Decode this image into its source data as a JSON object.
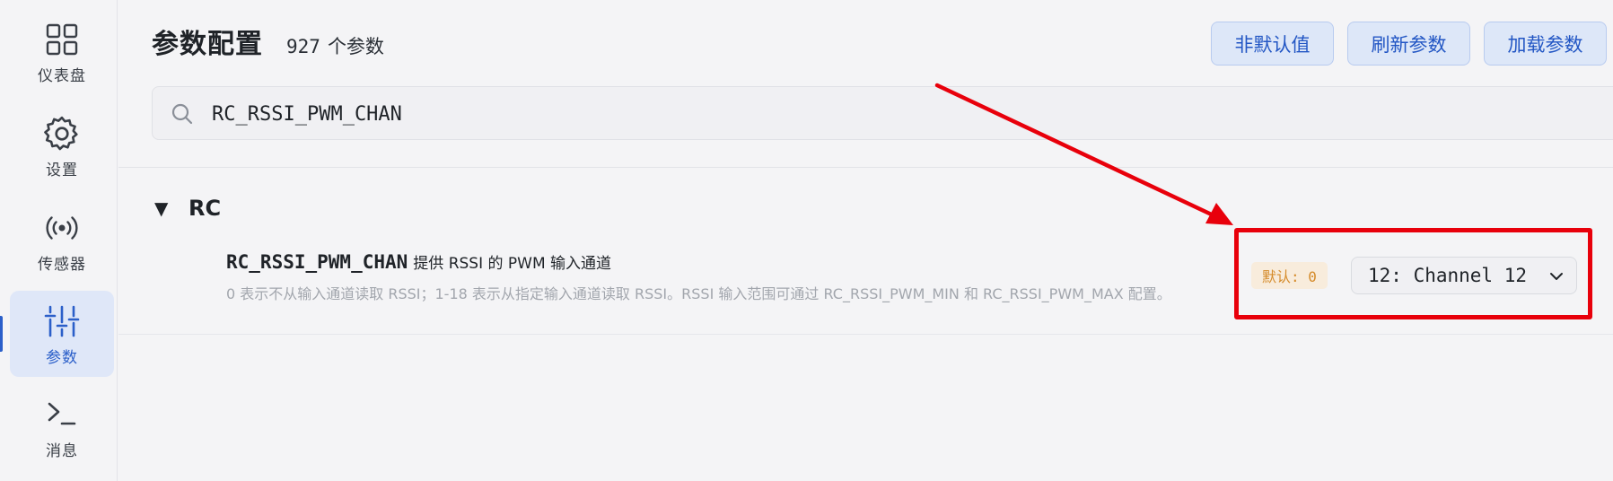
{
  "sidebar": {
    "items": [
      {
        "label": "仪表盘",
        "icon": "dashboard-grid-icon"
      },
      {
        "label": "设置",
        "icon": "gear-icon"
      },
      {
        "label": "传感器",
        "icon": "sensor-signal-icon"
      },
      {
        "label": "参数",
        "icon": "sliders-icon",
        "active": true
      },
      {
        "label": "消息",
        "icon": "terminal-icon"
      }
    ]
  },
  "header": {
    "title": "参数配置",
    "count": "927",
    "count_unit": "个参数",
    "buttons": {
      "non_default": "非默认值",
      "refresh": "刷新参数",
      "load": "加载参数"
    }
  },
  "search": {
    "value": "RC_RSSI_PWM_CHAN",
    "icon": "search-icon"
  },
  "group": {
    "title": "RC",
    "toggle": "▼",
    "params": [
      {
        "name": "RC_RSSI_PWM_CHAN",
        "short_desc": "提供 RSSI 的 PWM 输入通道",
        "long_desc": "0 表示不从输入通道读取 RSSI；1-18 表示从指定输入通道读取 RSSI。RSSI 输入范围可通过 RC_RSSI_PWM_MIN 和 RC_RSSI_PWM_MAX 配置。",
        "default_label": "默认: 0",
        "value": "12: Channel 12"
      }
    ]
  },
  "colors": {
    "accent": "#2b5fc9",
    "annotation": "#e8000b",
    "default_badge_text": "#d58b2a"
  }
}
